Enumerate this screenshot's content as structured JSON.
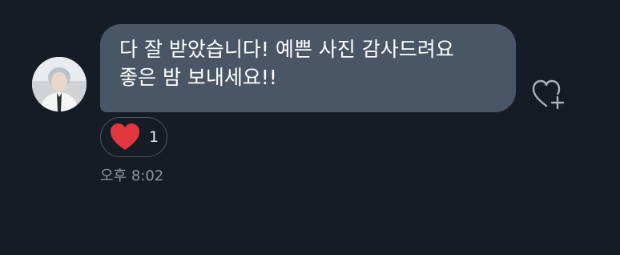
{
  "message": {
    "lines": [
      "다 잘 받았습니다! 예쁜 사진 감사드려요",
      "좋은 밤 보내세요!!"
    ],
    "reaction": {
      "count": "1"
    },
    "timestamp": "오후 8:02"
  },
  "colors": {
    "background": "#161c26",
    "bubble": "#4a5666",
    "heart": "#e0383e"
  }
}
